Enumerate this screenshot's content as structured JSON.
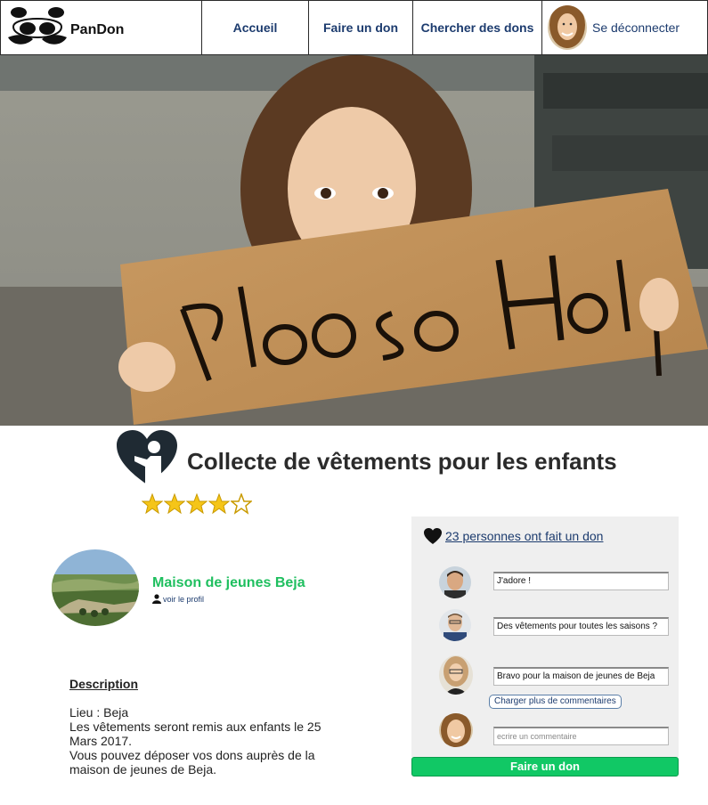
{
  "nav": {
    "brand": "PanDon",
    "links": [
      "Accueil",
      "Faire un don",
      "Chercher des dons"
    ],
    "logout": "Se déconnecter"
  },
  "hero": {
    "sign_text": "Please Help"
  },
  "campaign": {
    "title": "Collecte de vêtements pour les enfants",
    "rating": 4,
    "rating_max": 5
  },
  "organization": {
    "name": "Maison de jeunes Beja",
    "profile_link": "voir le profil"
  },
  "description": {
    "heading": "Description",
    "lines": [
      "Lieu : Beja",
      "Les vêtements seront remis aux enfants le 25 Mars 2017.",
      "Vous pouvez déposer vos dons auprès de la maison de jeunes de Beja."
    ]
  },
  "comments": {
    "likes_text": "23 personnes ont fait un don",
    "items": [
      "J'adore !",
      "Des vêtements pour toutes les saisons ?",
      "Bravo pour la maison de jeunes de Beja"
    ],
    "load_more": "Charger plus de commentaires",
    "placeholder": "ecrire un commentaire"
  },
  "donate_button": "Faire un don",
  "colors": {
    "accent_green": "#11c865",
    "link_blue": "#1c3b6e",
    "org_green": "#1fbf5f"
  }
}
